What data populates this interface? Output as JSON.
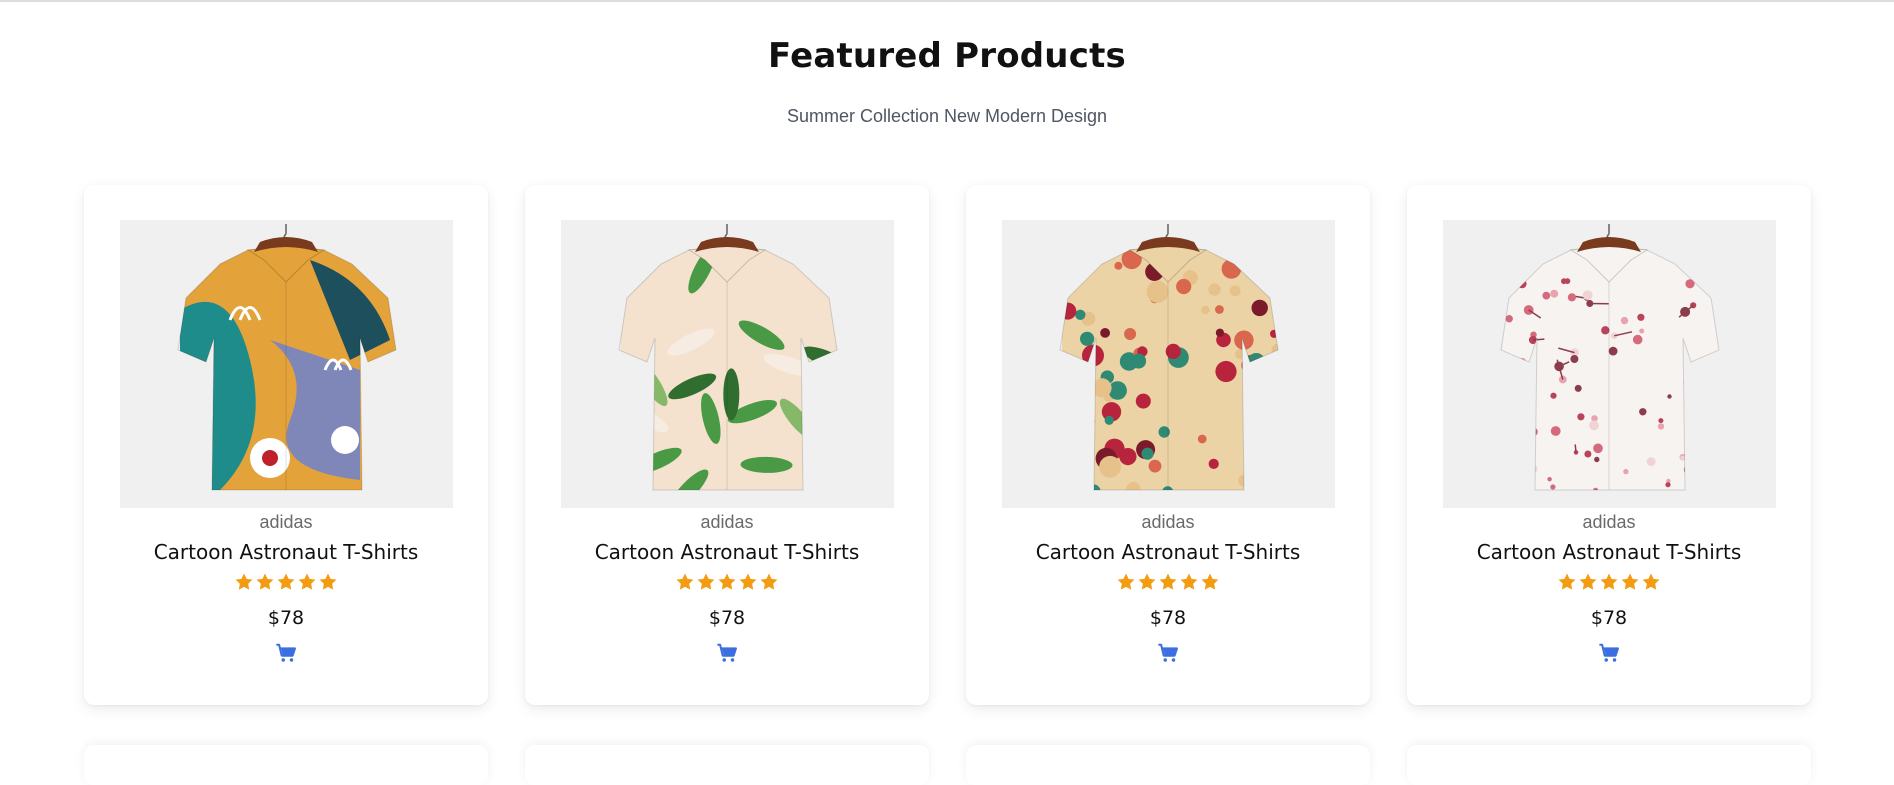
{
  "section": {
    "title": "Featured Products",
    "subtitle": "Summer Collection New Modern Design"
  },
  "products": [
    {
      "brand": "adidas",
      "name": "Cartoon Astronaut T-Shirts",
      "price": "$78",
      "rating": 5,
      "image": "shirt-abstract-print",
      "colors": [
        "#e3a23a",
        "#1f8c8c",
        "#7f86b8",
        "#ffffff",
        "#c0202a",
        "#1d4f5c"
      ]
    },
    {
      "brand": "adidas",
      "name": "Cartoon Astronaut T-Shirts",
      "price": "$78",
      "rating": 5,
      "image": "shirt-tropical-leaf-print",
      "colors": [
        "#f4e2cf",
        "#4a9a45",
        "#2f6e2f",
        "#f6ece1",
        "#e8b07a",
        "#86b86a"
      ]
    },
    {
      "brand": "adidas",
      "name": "Cartoon Astronaut T-Shirts",
      "price": "$78",
      "rating": 5,
      "image": "shirt-floral-print",
      "colors": [
        "#ecd3a6",
        "#b8243c",
        "#2f8a74",
        "#d8674e",
        "#7a1a2a",
        "#e6c28a"
      ]
    },
    {
      "brand": "adidas",
      "name": "Cartoon Astronaut T-Shirts",
      "price": "$78",
      "rating": 5,
      "image": "shirt-cherry-blossom-print",
      "colors": [
        "#f7f3f1",
        "#d46a7c",
        "#b9435a",
        "#e9a3ad",
        "#8c3c4b",
        "#f1d3d6"
      ]
    }
  ],
  "theme": {
    "star_color": "#f39c12",
    "cart_color": "#3b6fe0"
  }
}
